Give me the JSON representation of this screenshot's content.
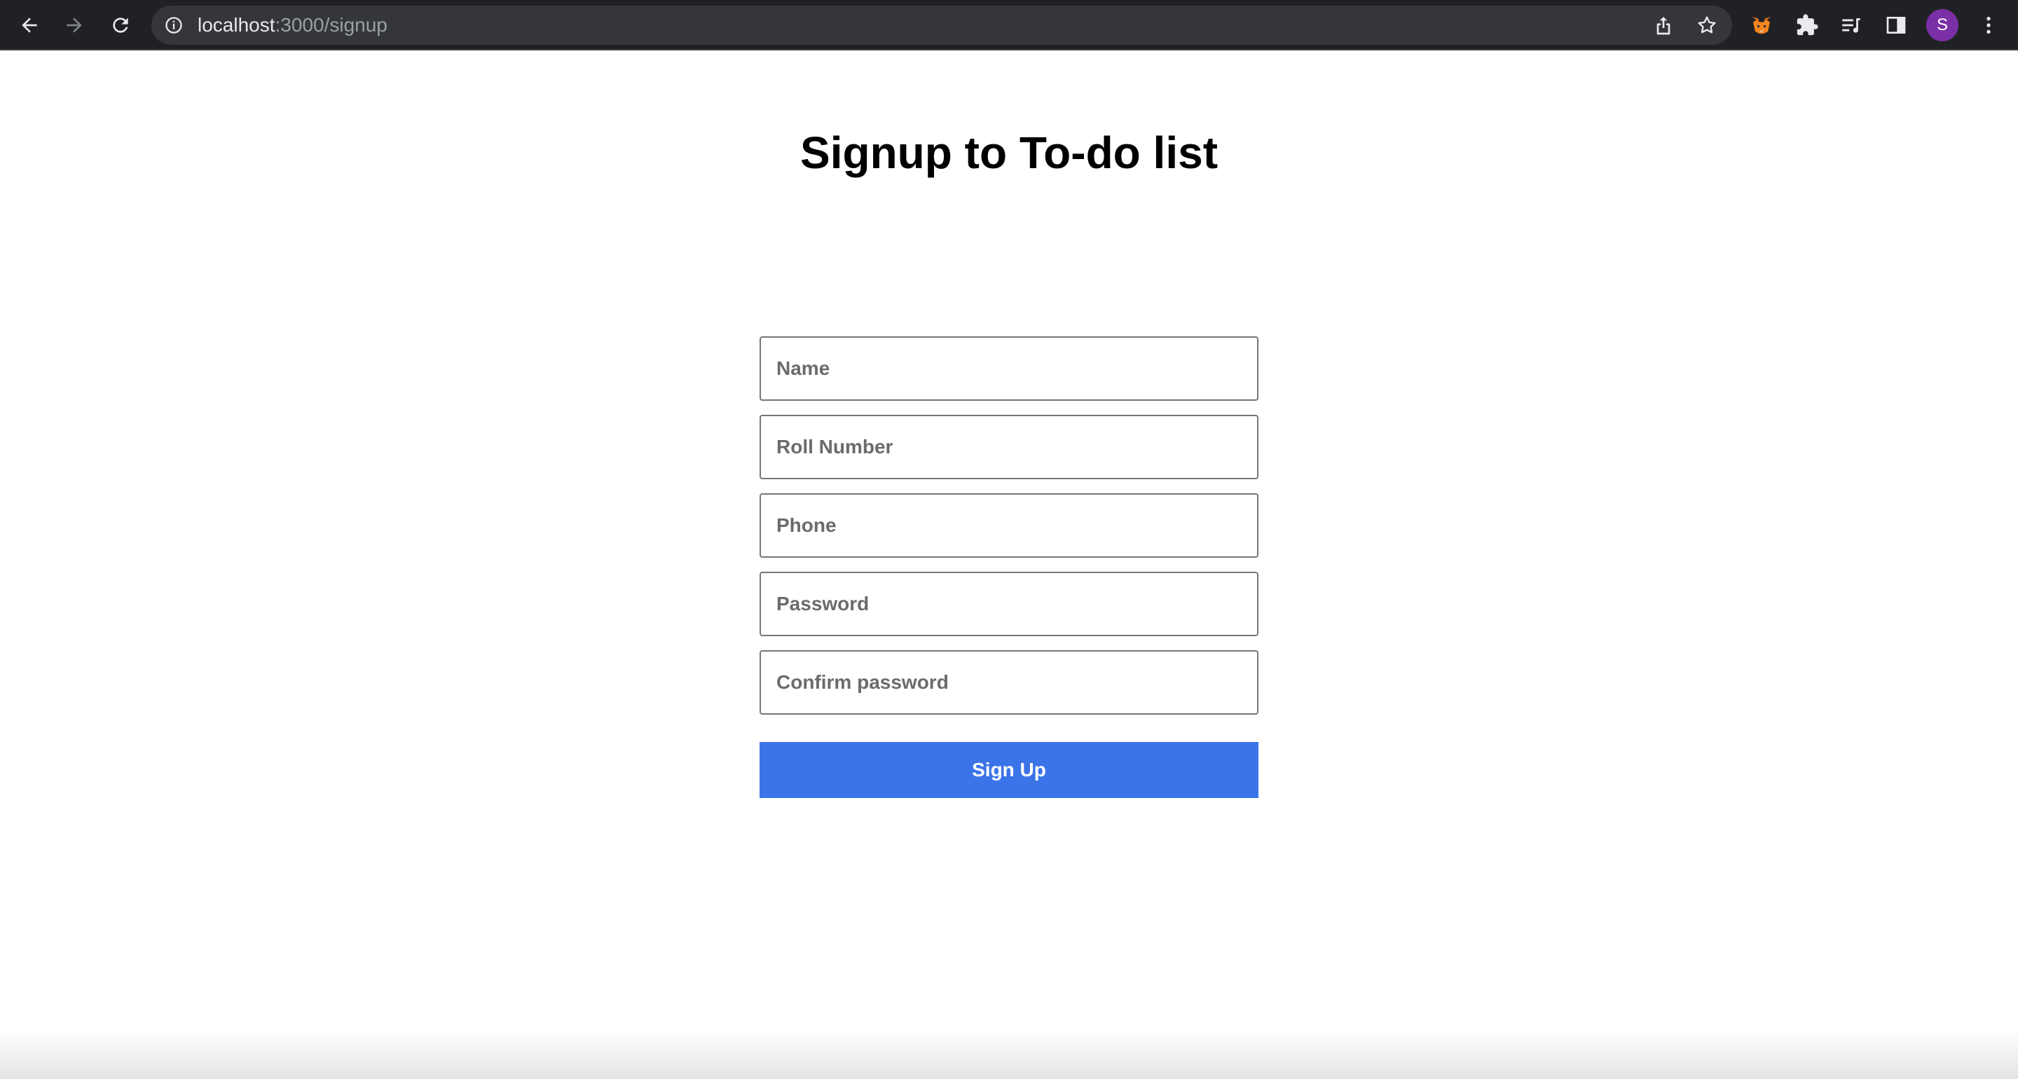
{
  "browser": {
    "url_host": "localhost",
    "url_path": ":3000/signup",
    "profile_initial": "S",
    "icons": {
      "back": "arrow-left-icon",
      "forward": "arrow-right-icon",
      "reload": "reload-icon",
      "site_info": "info-icon",
      "share": "share-icon",
      "bookmark": "star-icon",
      "metamask": "fox-icon",
      "extensions": "puzzle-icon",
      "reading_list": "reading-list-icon",
      "side_panel": "side-panel-icon",
      "menu": "kebab-menu-icon"
    }
  },
  "page": {
    "title": "Signup to To-do list"
  },
  "form": {
    "fields": [
      {
        "placeholder": "Name",
        "value": ""
      },
      {
        "placeholder": "Roll Number",
        "value": ""
      },
      {
        "placeholder": "Phone",
        "value": ""
      },
      {
        "placeholder": "Password",
        "value": ""
      },
      {
        "placeholder": "Confirm password",
        "value": ""
      }
    ],
    "submit_label": "Sign Up"
  },
  "colors": {
    "toolbar_bg": "#202124",
    "button_bg": "#3b74e8",
    "avatar_bg": "#7b2fa6"
  }
}
